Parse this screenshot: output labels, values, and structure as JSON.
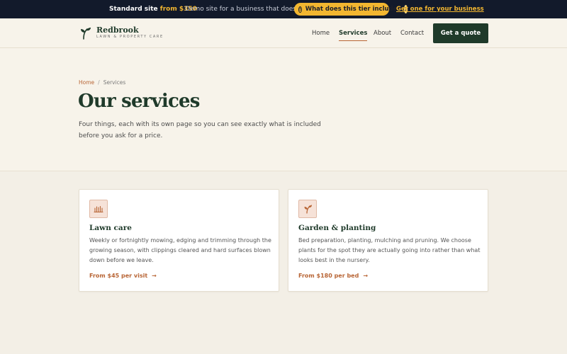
{
  "topbar": {
    "standard_label": "Standard site",
    "standard_price": "from $350",
    "separator": "·",
    "demo_text": "Demo site for a business that does not exist",
    "pill_label": "What does this tier include?",
    "pill_count": "1",
    "cta_link": "Get one for your business",
    "accent_color": "#f2b630"
  },
  "header": {
    "brand_name": "Redbrook",
    "brand_tagline": "LAWN & PROPERTY CARE",
    "nav": [
      {
        "label": "Home",
        "active": false
      },
      {
        "label": "Services",
        "active": true
      },
      {
        "label": "About",
        "active": false
      },
      {
        "label": "Contact",
        "active": false
      }
    ],
    "cta_label": "Get a quote",
    "brand_color": "#1f3a2a"
  },
  "hero": {
    "breadcrumb": {
      "home": "Home",
      "separator": "/",
      "current": "Services"
    },
    "title": "Our services",
    "subtitle": "Four things, each with its own page so you can see exactly what is included before you ask for a price."
  },
  "services": [
    {
      "icon": "grass-icon",
      "title": "Lawn care",
      "description": "Weekly or fortnightly mowing, edging and trimming through the growing season, with clippings cleared and hard surfaces blown down before we leave.",
      "price": "From $45 per visit",
      "arrow": "→"
    },
    {
      "icon": "sprout-icon",
      "title": "Garden & planting",
      "description": "Bed preparation, planting, mulching and pruning. We choose plants for the spot they are actually going into rather than what looks best in the nursery.",
      "price": "From $180 per bed",
      "arrow": "→"
    }
  ],
  "accent_color": "#b86535"
}
